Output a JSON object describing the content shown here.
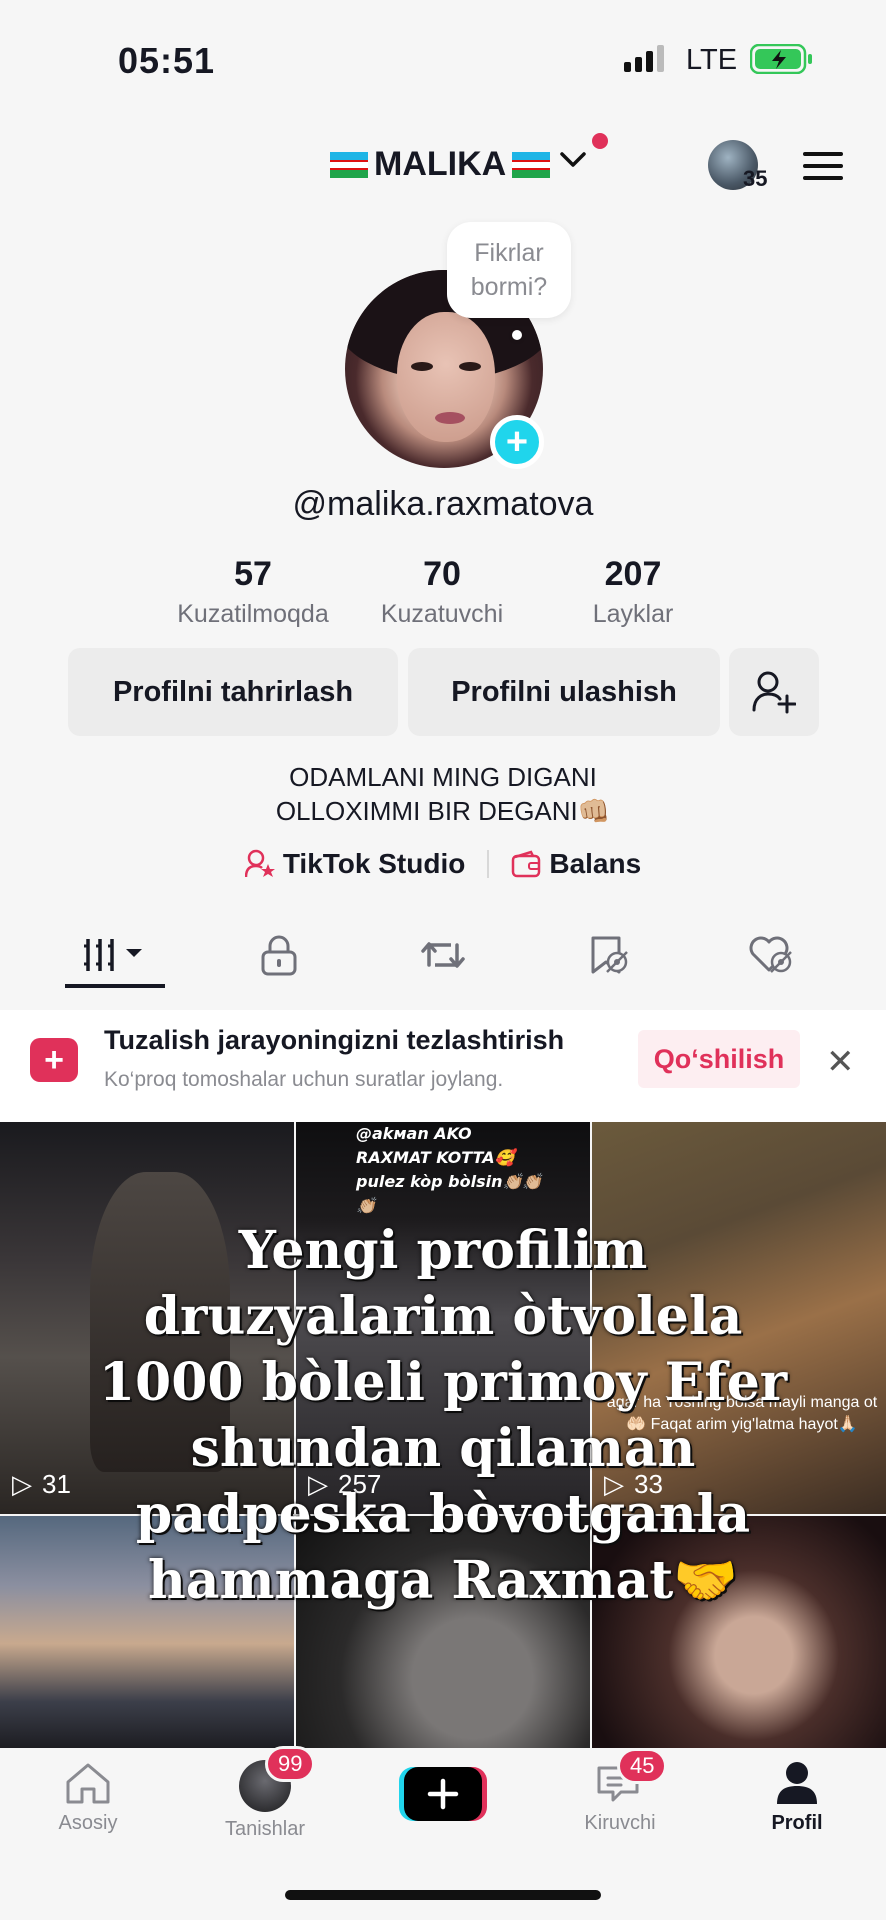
{
  "status": {
    "time": "05:51",
    "network": "LTE"
  },
  "header": {
    "title": "MALIKA",
    "story_count": "35"
  },
  "profile": {
    "thought_bubble": [
      "Fikrlar",
      "bormi?"
    ],
    "username": "@malika.raxmatova",
    "stats": [
      {
        "value": "57",
        "label": "Kuzatilmoqda"
      },
      {
        "value": "70",
        "label": "Kuzatuvchi"
      },
      {
        "value": "207",
        "label": "Layklar"
      }
    ],
    "edit_label": "Profilni tahrirlash",
    "share_label": "Profilni ulashish",
    "bio": [
      "ODAMLANI MING DIGANI",
      "OLLOXIMMI BIR DEGANI👊🏼"
    ],
    "studio_label": "TikTok Studio",
    "balance_label": "Balans"
  },
  "tabs": [
    "videos-grid-icon",
    "lock-icon",
    "repost-icon",
    "favorites-icon",
    "liked-icon"
  ],
  "banner": {
    "title": "Tuzalish jarayoningizni tezlashtirish",
    "subtitle": "Ko‘proq tomoshalar uchun suratlar joylang.",
    "action": "Qo‘shilish"
  },
  "grid": {
    "videos": [
      {
        "views": "31",
        "caption": ""
      },
      {
        "views": "257",
        "caption": "@akмаn AKO RAXMAT KOTTA🥰 pulez kòp bòlsin👏🏼👏🏼👏🏼"
      },
      {
        "views": "33",
        "caption": "agar ha Yoshing bolsa mayli manga ot 🤲🏻 Faqat arim yig'latma hayot🙏🏻"
      },
      {
        "views": "",
        "caption": ""
      },
      {
        "views": "",
        "caption": ""
      },
      {
        "views": "",
        "caption": ""
      }
    ],
    "overlay_text": [
      "Yengi profilim",
      "druzyalarim òtvolela",
      "1000 bòleli primoy Efer",
      "shundan qilaman",
      "padpeska bòvotganla",
      "hammaga Raxmat🤝"
    ]
  },
  "nav": {
    "home": "Asosiy",
    "friends": "Tanishlar",
    "friends_badge": "99",
    "inbox": "Kiruvchi",
    "inbox_badge": "45",
    "profile": "Profil"
  },
  "colors": {
    "accent": "#e0315a",
    "teal": "#20d5ec",
    "text": "#161823"
  }
}
